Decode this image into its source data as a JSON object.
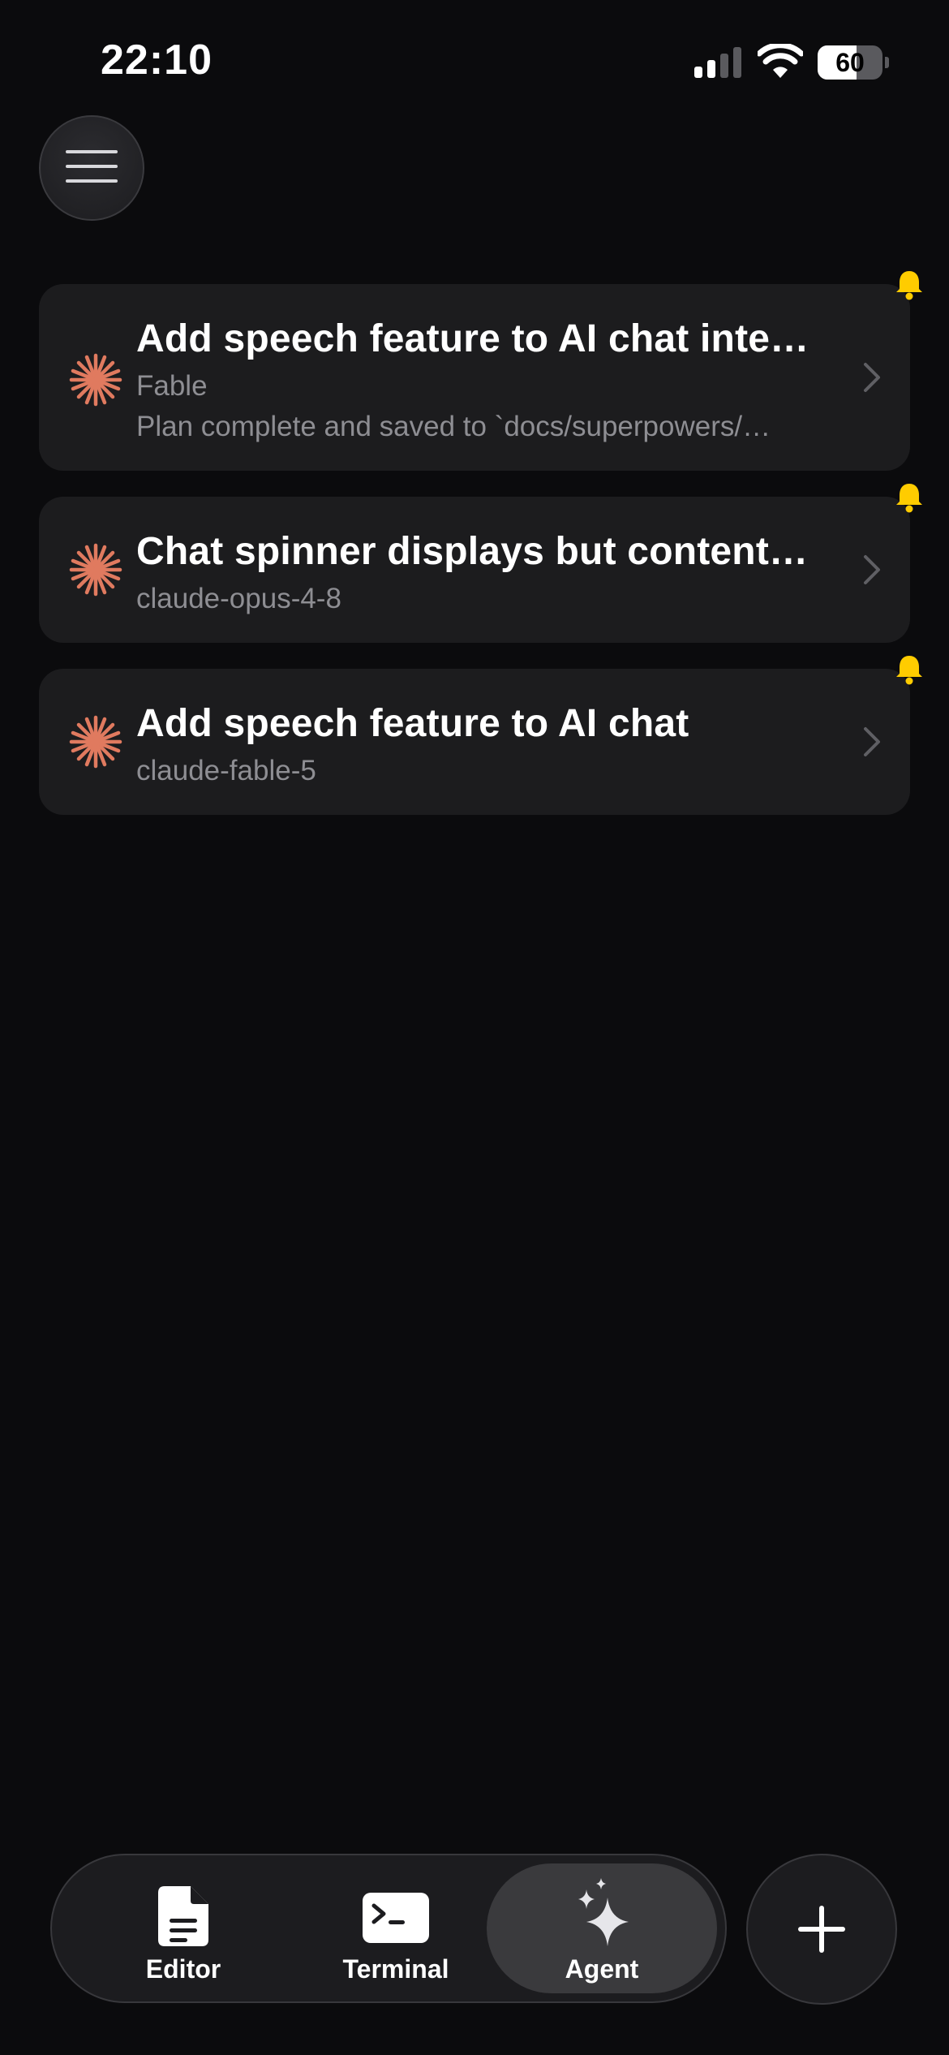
{
  "status_bar": {
    "time": "22:10",
    "battery_level": "60",
    "battery_fraction": 0.6,
    "signal_icon": "cellular-signal-icon",
    "wifi_icon": "wifi-icon"
  },
  "header": {
    "menu_icon": "hamburger-menu-icon"
  },
  "tasks": [
    {
      "title": "Add speech feature to AI chat inte…",
      "subtitle": "Fable",
      "preview": "Plan complete and saved to `docs/superpowers/…",
      "has_notification": true
    },
    {
      "title": "Chat spinner displays but content…",
      "subtitle": "claude-opus-4-8",
      "has_notification": true
    },
    {
      "title": "Add speech feature to AI chat",
      "subtitle": "claude-fable-5",
      "has_notification": true
    }
  ],
  "tab_bar": {
    "tabs": [
      {
        "label": "Editor",
        "icon": "document-icon",
        "selected": false
      },
      {
        "label": "Terminal",
        "icon": "terminal-icon",
        "selected": false
      },
      {
        "label": "Agent",
        "icon": "sparkles-icon",
        "selected": true
      }
    ],
    "add_icon": "plus-icon"
  },
  "colors": {
    "background": "#0b0b0d",
    "card": "#1c1c1e",
    "accent_agent": "#e07a5f",
    "notification": "#ffcc00",
    "secondary_text": "#8e8e93"
  }
}
